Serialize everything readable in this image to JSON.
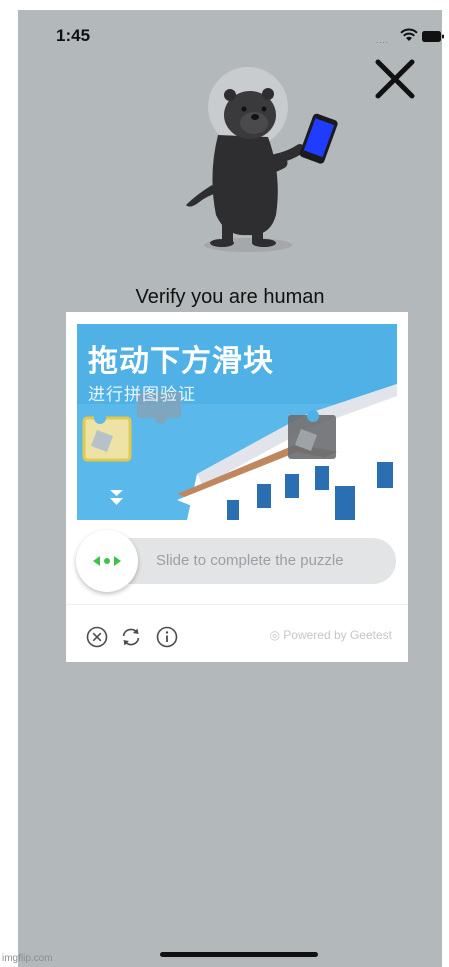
{
  "status_bar": {
    "time": "1:45",
    "signal_dots": "....",
    "wifi_icon": "wifi-icon",
    "battery_icon": "battery-icon"
  },
  "header": {
    "close_icon": "close-icon"
  },
  "verify": {
    "title": "Verify you are human"
  },
  "captcha": {
    "image_title": "拖动下方滑块",
    "image_subtitle": "进行拼图验证",
    "slider_hint": "Slide to complete the puzzle",
    "refresh_icon": "refresh-icon",
    "close_icon": "circle-x-icon",
    "info_icon": "info-icon",
    "powered_by": "Powered by Geetest"
  },
  "footer": {
    "watermark": "imgflip.com"
  },
  "colors": {
    "background": "#b3b8bb",
    "sky": "#5ab8ea",
    "slider_arrow": "#3cc24a"
  }
}
